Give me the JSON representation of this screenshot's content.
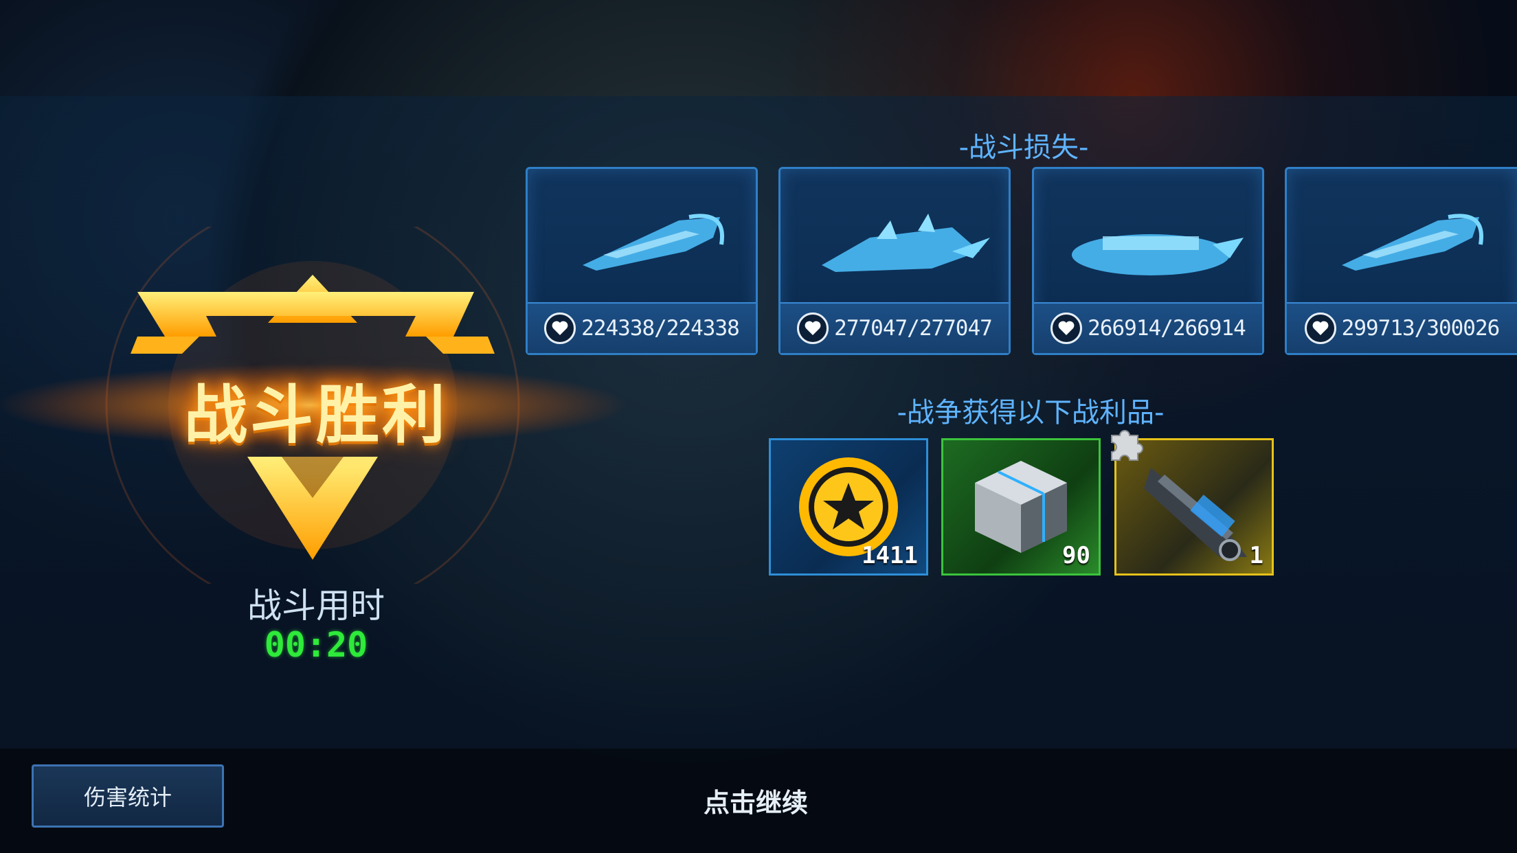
{
  "victory": {
    "title": "战斗胜利",
    "time_label": "战斗用时",
    "time_value": "00:20"
  },
  "losses": {
    "title": "-战斗损失-",
    "ships": [
      {
        "hp": "224338/224338"
      },
      {
        "hp": "277047/277047"
      },
      {
        "hp": "266914/266914"
      },
      {
        "hp": "299713/300026"
      }
    ]
  },
  "rewards": {
    "title": "-战争获得以下战利品-",
    "items": [
      {
        "icon": "coin-star-icon",
        "count": "1411"
      },
      {
        "icon": "metal-cube-icon",
        "count": "90"
      },
      {
        "icon": "weapon-fragment-icon",
        "count": "1"
      }
    ]
  },
  "bottom": {
    "damage_stats_label": "伤害统计",
    "continue_hint": "点击继续"
  },
  "colors": {
    "accent_blue": "#5fb4ff",
    "time_green": "#2eea3a",
    "victory_gold": "#ffc21a"
  }
}
